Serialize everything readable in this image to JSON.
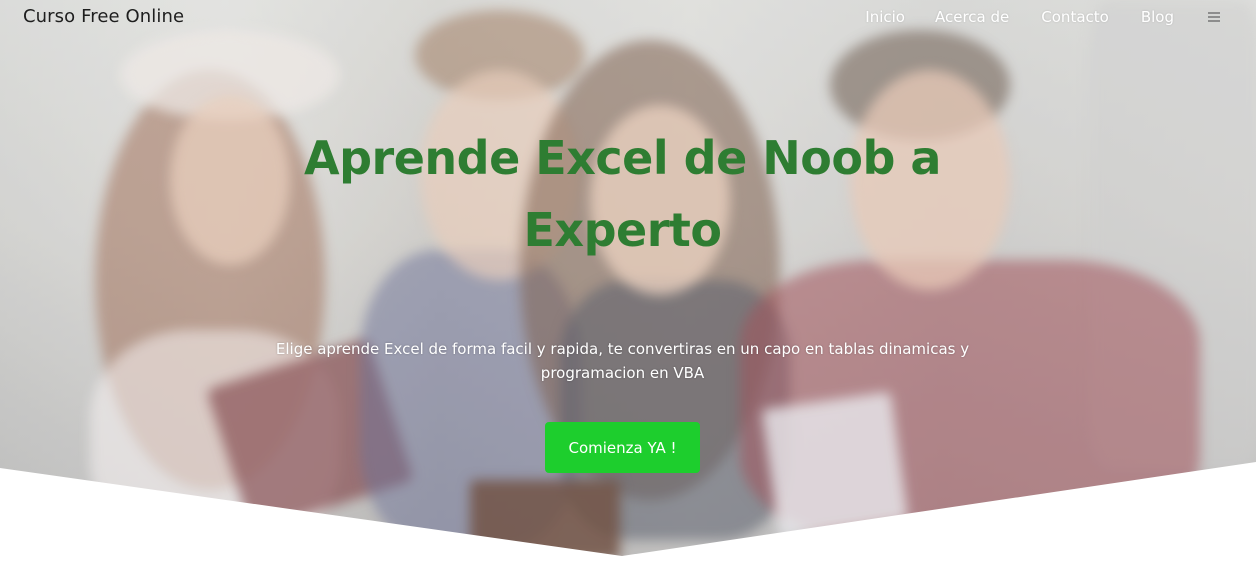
{
  "nav": {
    "brand": "Curso Free Online",
    "links": [
      {
        "label": "Inicio"
      },
      {
        "label": "Acerca de"
      },
      {
        "label": "Contacto"
      },
      {
        "label": "Blog"
      }
    ],
    "menu_icon": "hamburger-menu-icon"
  },
  "hero": {
    "title_line1": "Aprende Excel de Noob a",
    "title_line2": "Experto",
    "subtitle_line1": "Elige aprende Excel de forma facil y rapida, te convertiras en un capo en tablas dinamicas y",
    "subtitle_line2": "programacion en VBA",
    "cta_label": "Comienza YA !",
    "background": "photo-of-smiling-students"
  },
  "colors": {
    "title": "#2e7d32",
    "cta": "#1dce2d",
    "nav_text": "#ffffff",
    "brand_text": "#1e1e1e"
  }
}
